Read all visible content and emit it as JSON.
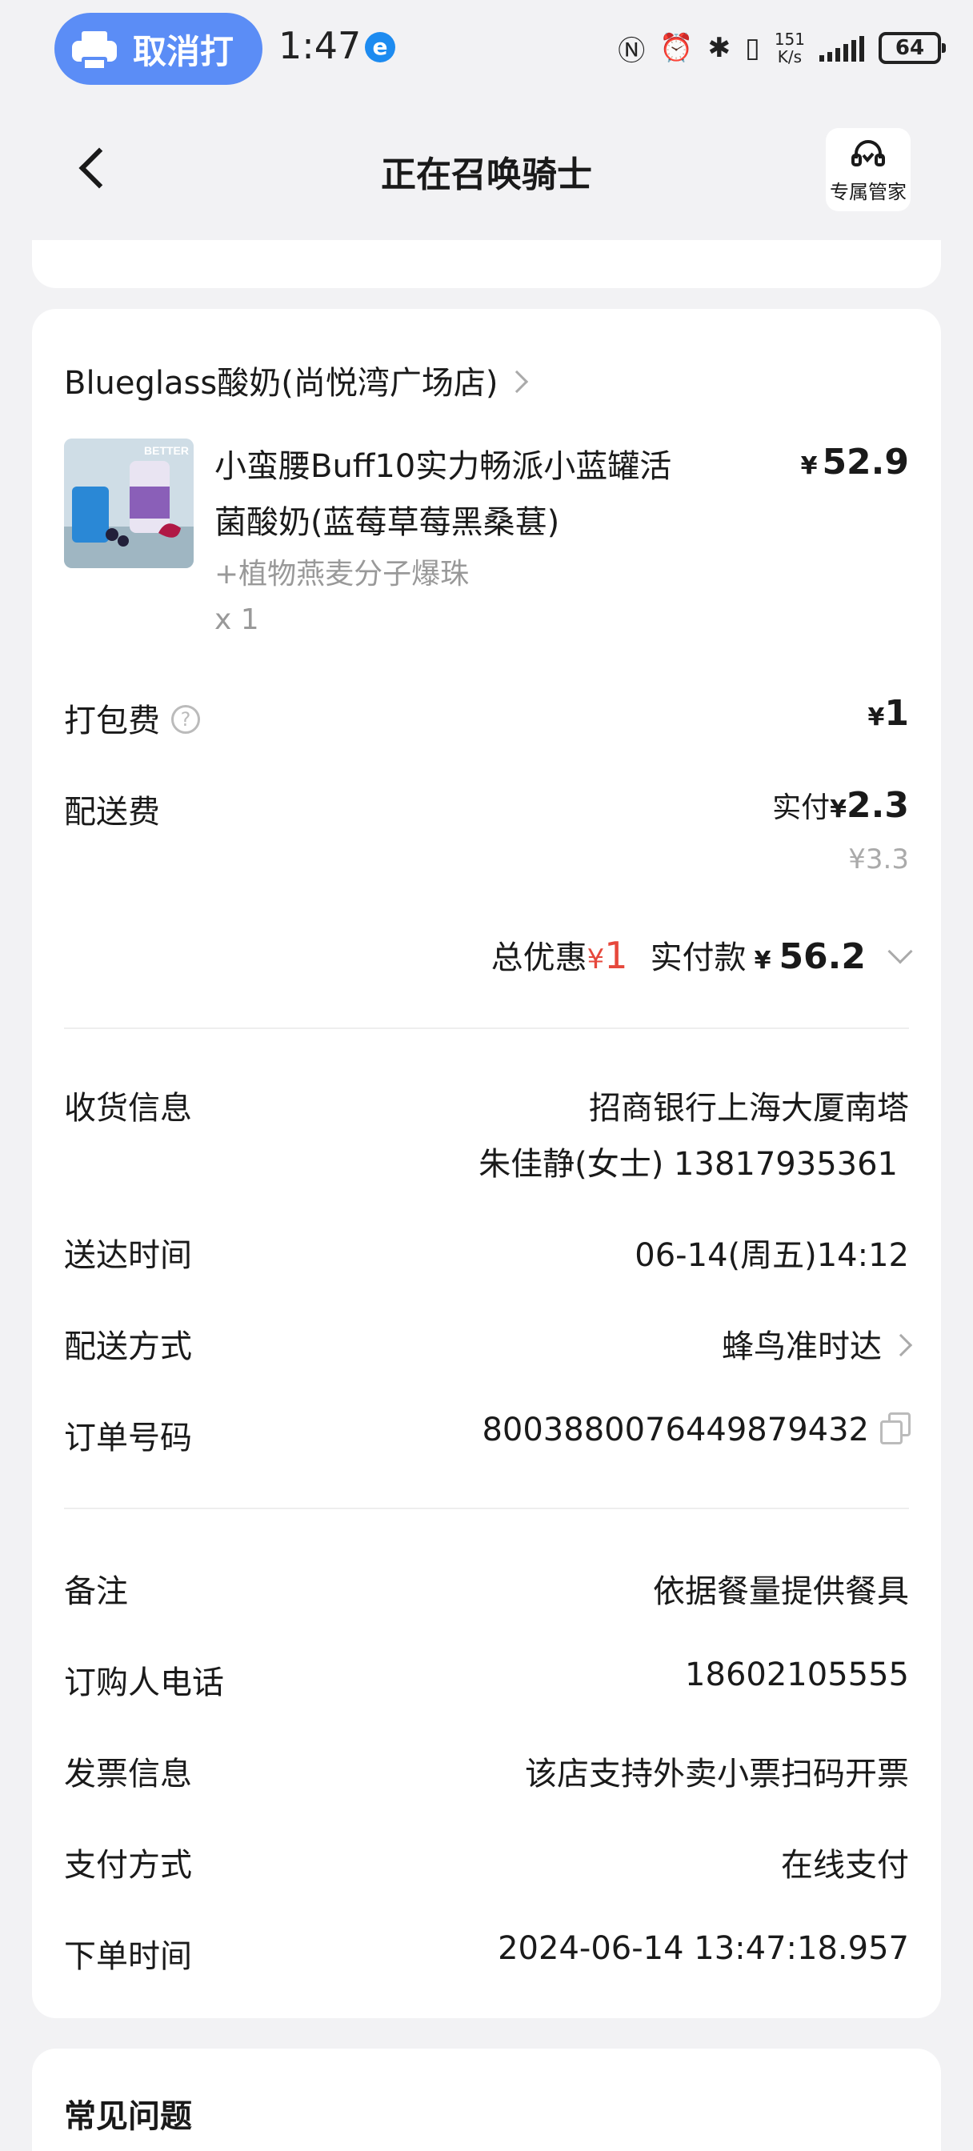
{
  "status_bar": {
    "cast_label": "取消打",
    "time": "1:47",
    "e_badge": "e",
    "net_speed_value": "151",
    "net_speed_unit": "K/s",
    "battery": "64"
  },
  "header": {
    "title": "正在召唤骑士",
    "service_label": "专属管家"
  },
  "order": {
    "store_name": "Blueglass酸奶(尚悦湾广场店)",
    "product": {
      "name": "小蛮腰Buff10实力畅派小蓝罐活菌酸奶(蓝莓草莓黑桑葚)",
      "price_symbol": "¥",
      "price": "52.9",
      "addon": "+植物燕麦分子爆珠",
      "quantity": "x 1",
      "image_label": "BETTER"
    },
    "packing_fee": {
      "label": "打包费",
      "symbol": "¥",
      "value": "1"
    },
    "delivery_fee": {
      "label": "配送费",
      "paid_prefix": "实付",
      "symbol": "¥",
      "value": "2.3",
      "original": "¥3.3"
    },
    "summary": {
      "discount_label": "总优惠",
      "discount_symbol": "¥",
      "discount_value": "1",
      "paid_label": "实付款",
      "paid_symbol": "¥",
      "paid_value": "56.2"
    }
  },
  "delivery_info": {
    "address_label": "收货信息",
    "address": "招商银行上海大厦南塔",
    "contact": "朱佳静(女士) 13817935361",
    "time_label": "送达时间",
    "time_value": "06-14(周五)14:12",
    "method_label": "配送方式",
    "method_value": "蜂鸟准时达",
    "order_no_label": "订单号码",
    "order_no_value": "8003880076449879432"
  },
  "extra_info": {
    "note_label": "备注",
    "note_value": "依据餐量提供餐具",
    "phone_label": "订购人电话",
    "phone_value": "18602105555",
    "invoice_label": "发票信息",
    "invoice_value": "该店支持外卖小票扫码开票",
    "payment_label": "支付方式",
    "payment_value": "在线支付",
    "order_time_label": "下单时间",
    "order_time_value": "2024-06-14 13:47:18.957"
  },
  "faq": {
    "title": "常见问题"
  }
}
